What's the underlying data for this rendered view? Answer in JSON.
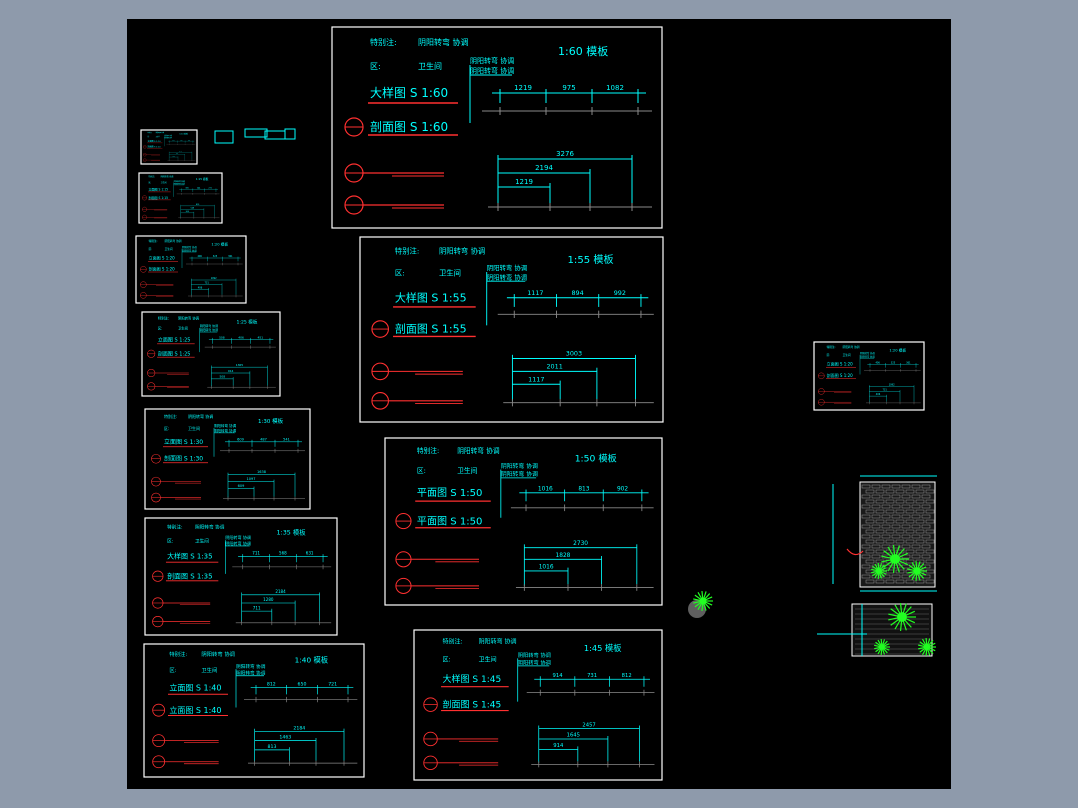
{
  "canvas": {
    "background": "#000000",
    "frame": "#8e9aab"
  },
  "colors": {
    "frame_line": "#ffffff",
    "dim": "#00ffff",
    "accent": "#ff3030",
    "base_line": "#8a8a8a",
    "plant": "#22ff22"
  },
  "common": {
    "notes_label": "特别注:",
    "notes_value": "阴阳转弯 协调",
    "area_label": "区:",
    "area_value": "卫生间"
  },
  "templates": [
    {
      "scale_title": "1:60  模板",
      "title1": "大样图  S  1:60",
      "title2": "剖面图  S  1:60",
      "dims": [
        "1219",
        "975",
        "1082"
      ],
      "total": "3276",
      "mid": "2194",
      "short": "1219"
    },
    {
      "scale_title": "1:55  模板",
      "title1": "大样图  S  1:55",
      "title2": "剖面图  S  1:55",
      "dims": [
        "1117",
        "894",
        "992"
      ],
      "total": "3003",
      "mid": "2011",
      "short": "1117"
    },
    {
      "scale_title": "1:50  模板",
      "title1": "平面图  S  1:50",
      "title2": "平面图  S  1:50",
      "dims": [
        "1016",
        "813",
        "902"
      ],
      "total": "2730",
      "mid": "1828",
      "short": "1016"
    },
    {
      "scale_title": "1:45  模板",
      "title1": "大样图  S  1:45",
      "title2": "剖面图  S  1:45",
      "dims": [
        "914",
        "731",
        "812"
      ],
      "total": "2457",
      "mid": "1645",
      "short": "914"
    },
    {
      "scale_title": "1:40  模板",
      "title1": "立面图  S  1:40",
      "title2": "立面图  S  1:40",
      "dims": [
        "812",
        "650",
        "721"
      ],
      "total": "2184",
      "mid": "1463",
      "short": "813"
    },
    {
      "scale_title": "1:35  模板",
      "title1": "大样图  S  1:35",
      "title2": "剖面图  S  1:35",
      "dims": [
        "711",
        "568",
        "631"
      ],
      "total": "2184",
      "mid": "1280",
      "short": "711"
    },
    {
      "scale_title": "1:30  模板",
      "title1": "立面图  S  1:30",
      "title2": "剖面图  S  1:30",
      "dims": [
        "609",
        "487",
        "541"
      ],
      "total": "1638",
      "mid": "1097",
      "short": "609"
    },
    {
      "scale_title": "1:25  模板",
      "title1": "立面图  S  1:25",
      "title2": "剖面图  S  1:25",
      "dims": [
        "508",
        "406",
        "451"
      ],
      "total": "1365",
      "mid": "914",
      "short": "508"
    },
    {
      "scale_title": "1:20  模板",
      "title1": "立面图  S  1:20",
      "title2": "剖面图  S  1:20",
      "dims": [
        "406",
        "325",
        "361"
      ],
      "total": "1092",
      "mid": "731",
      "short": "406"
    },
    {
      "scale_title": "1:15  模板",
      "title1": "立面图  S  1:15",
      "title2": "剖面图  S  1:15",
      "dims": [
        "305",
        "244",
        "271"
      ],
      "total": "819",
      "mid": "548",
      "short": "305"
    },
    {
      "scale_title": "1:10  模板",
      "title1": "立面图  S  1:10",
      "title2": "剖面图  S  1:10",
      "dims": [
        "203",
        "163",
        "180"
      ],
      "total": "546",
      "mid": "366",
      "short": "203"
    },
    {
      "scale_title": "1:20  模板",
      "title1": "立面图  S  1:20",
      "title2": "剖面图  S  1:20",
      "dims": [
        "406",
        "325",
        "361"
      ],
      "total": "1092",
      "mid": "731",
      "short": "406"
    }
  ]
}
